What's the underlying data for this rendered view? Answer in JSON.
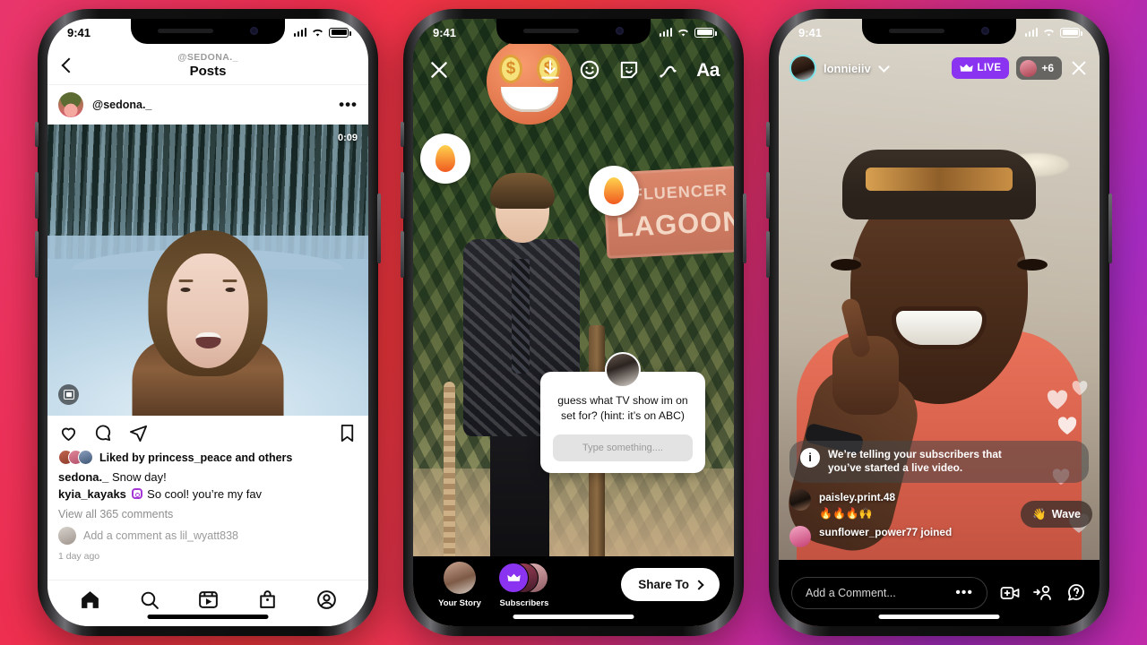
{
  "background": {
    "from": "#e8366d",
    "mid": "#f0373c",
    "to": "#a42bc0"
  },
  "phone1": {
    "status": {
      "time": "9:41"
    },
    "nav": {
      "back_icon": "chevron-left-icon",
      "subtitle": "@SEDONA._",
      "title": "Posts"
    },
    "post": {
      "username": "@sedona._",
      "more_label": "•••",
      "media": {
        "duration": "0:09",
        "audio_icon": "audio-badge-icon"
      },
      "actions": {
        "like": "heart-icon",
        "comment": "comment-icon",
        "share": "share-icon",
        "save": "bookmark-icon"
      },
      "liked_by": "Liked by princess_peace and others",
      "caption_user": "sedona._",
      "caption_text": "Snow day!",
      "comment_user": "kyia_kayaks",
      "comment_text": "So cool! you’re my fav",
      "view_all": "View all 365 comments",
      "add_comment": "Add a comment as lil_wyatt838",
      "timeago": "1 day ago"
    },
    "tabs": [
      {
        "name": "home",
        "icon": "home-icon"
      },
      {
        "name": "search",
        "icon": "search-icon"
      },
      {
        "name": "reels",
        "icon": "reels-icon"
      },
      {
        "name": "shop",
        "icon": "shop-icon"
      },
      {
        "name": "profile",
        "icon": "profile-icon"
      }
    ]
  },
  "phone2": {
    "status": {
      "time": "9:41"
    },
    "toolbar": [
      {
        "name": "close",
        "icon": "close-icon",
        "label": "✕"
      },
      {
        "name": "save",
        "icon": "download-icon"
      },
      {
        "name": "effects",
        "icon": "smiley-face-icon"
      },
      {
        "name": "stickers",
        "icon": "sticker-icon"
      },
      {
        "name": "draw",
        "icon": "squiggle-draw-icon"
      },
      {
        "name": "text",
        "icon": "text-icon",
        "label": "Aa"
      }
    ],
    "sign": {
      "line1": "INFLUENCER",
      "line2": "LAGOON"
    },
    "question_sticker": {
      "prompt": "guess what TV show im on set for? (hint: it’s on ABC)",
      "input_placeholder": "Type something...."
    },
    "destinations": [
      {
        "label": "Your Story",
        "icon": "your-story-avatar"
      },
      {
        "label": "Subscribers",
        "icon": "subscribers-crown-icon"
      }
    ],
    "share_button": {
      "label": "Share To",
      "icon": "chevron-right-icon"
    }
  },
  "phone3": {
    "status": {
      "time": "9:41"
    },
    "header": {
      "username": "lonnieiiv",
      "chevron_icon": "chevron-down-icon",
      "live_label": "LIVE",
      "live_icon": "crown-icon",
      "live_color": "#8a33f0",
      "viewers": "+6",
      "close_icon": "close-icon"
    },
    "comments": [
      {
        "type": "system",
        "icon": "info-icon",
        "text": "We’re telling your subscribers that you’ve started a live video."
      },
      {
        "type": "comment",
        "user": "paisley.print.48",
        "message": "🔥🔥🔥🙌"
      },
      {
        "type": "join",
        "user": "sunflower_power77 joined",
        "message": ""
      }
    ],
    "wave_button": {
      "label": "Wave",
      "icon": "wave-hand-icon"
    },
    "bottom": {
      "comment_placeholder": "Add a Comment...",
      "more_icon": "ellipsis-icon",
      "video_icon": "add-video-icon",
      "invite_icon": "invite-person-icon",
      "help_icon": "question-help-icon"
    }
  }
}
